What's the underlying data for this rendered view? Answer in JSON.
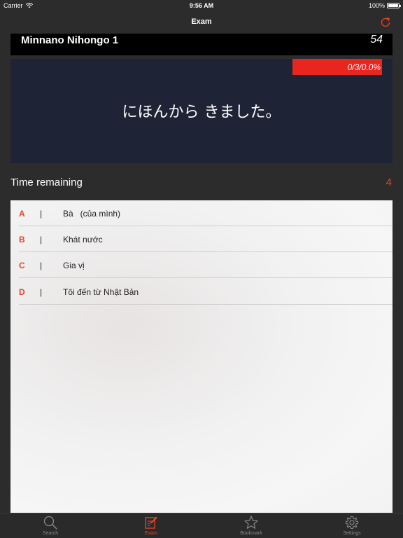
{
  "status_bar": {
    "carrier": "Carrier",
    "time": "9:56 AM",
    "battery": "100%"
  },
  "nav": {
    "title": "Exam"
  },
  "header": {
    "course": "Minnano Nihongo 1",
    "count": "54"
  },
  "question": {
    "progress": "0/3/0.0%",
    "text": "にほんから きました。"
  },
  "timer": {
    "label": "Time remaining",
    "value": "4"
  },
  "answers": [
    {
      "letter": "A",
      "sep": "|",
      "text": "Bà   (của mình)"
    },
    {
      "letter": "B",
      "sep": "|",
      "text": "Khát nước"
    },
    {
      "letter": "C",
      "sep": "|",
      "text": "Gia vị"
    },
    {
      "letter": "D",
      "sep": "|",
      "text": "Tôi đến từ Nhật Bản"
    }
  ],
  "tabs": [
    {
      "label": "Search",
      "icon": "search-icon"
    },
    {
      "label": "Exam",
      "icon": "exam-icon"
    },
    {
      "label": "Bookmark",
      "icon": "star-icon"
    },
    {
      "label": "Settings",
      "icon": "gear-icon"
    }
  ],
  "colors": {
    "accent": "#e8462a",
    "progress": "#e8251e",
    "panel": "#1e2436",
    "background": "#2c2c2c"
  }
}
